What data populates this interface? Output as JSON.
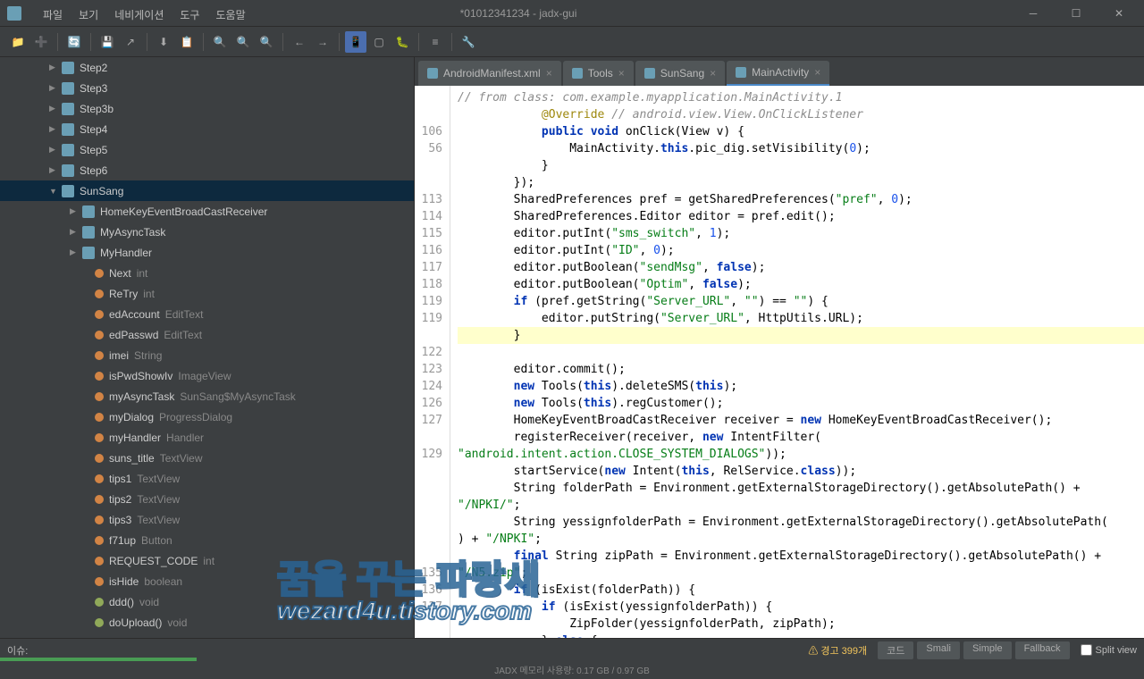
{
  "window": {
    "title": "*01012341234 - jadx-gui"
  },
  "menu": [
    "파일",
    "보기",
    "네비게이션",
    "도구",
    "도움말"
  ],
  "tree": [
    {
      "indent": 55,
      "arrow": "▶",
      "icon": "class",
      "name": "Step2",
      "type": ""
    },
    {
      "indent": 55,
      "arrow": "▶",
      "icon": "class",
      "name": "Step3",
      "type": ""
    },
    {
      "indent": 55,
      "arrow": "▶",
      "icon": "class",
      "name": "Step3b",
      "type": ""
    },
    {
      "indent": 55,
      "arrow": "▶",
      "icon": "class",
      "name": "Step4",
      "type": ""
    },
    {
      "indent": 55,
      "arrow": "▶",
      "icon": "class",
      "name": "Step5",
      "type": ""
    },
    {
      "indent": 55,
      "arrow": "▶",
      "icon": "class",
      "name": "Step6",
      "type": ""
    },
    {
      "indent": 55,
      "arrow": "▼",
      "icon": "class",
      "name": "SunSang",
      "type": "",
      "selected": true
    },
    {
      "indent": 78,
      "arrow": "▶",
      "icon": "class",
      "name": "HomeKeyEventBroadCastReceiver",
      "type": ""
    },
    {
      "indent": 78,
      "arrow": "▶",
      "icon": "class",
      "name": "MyAsyncTask",
      "type": ""
    },
    {
      "indent": 78,
      "arrow": "▶",
      "icon": "class",
      "name": "MyHandler",
      "type": ""
    },
    {
      "indent": 92,
      "arrow": "",
      "icon": "field",
      "name": "Next",
      "type": "int"
    },
    {
      "indent": 92,
      "arrow": "",
      "icon": "field",
      "name": "ReTry",
      "type": "int"
    },
    {
      "indent": 92,
      "arrow": "",
      "icon": "field",
      "name": "edAccount",
      "type": "EditText"
    },
    {
      "indent": 92,
      "arrow": "",
      "icon": "field",
      "name": "edPasswd",
      "type": "EditText"
    },
    {
      "indent": 92,
      "arrow": "",
      "icon": "field",
      "name": "imei",
      "type": "String"
    },
    {
      "indent": 92,
      "arrow": "",
      "icon": "field",
      "name": "isPwdShowIv",
      "type": "ImageView"
    },
    {
      "indent": 92,
      "arrow": "",
      "icon": "field",
      "name": "myAsyncTask",
      "type": "SunSang$MyAsyncTask"
    },
    {
      "indent": 92,
      "arrow": "",
      "icon": "field",
      "name": "myDialog",
      "type": "ProgressDialog"
    },
    {
      "indent": 92,
      "arrow": "",
      "icon": "field",
      "name": "myHandler",
      "type": "Handler"
    },
    {
      "indent": 92,
      "arrow": "",
      "icon": "field",
      "name": "suns_title",
      "type": "TextView"
    },
    {
      "indent": 92,
      "arrow": "",
      "icon": "field",
      "name": "tips1",
      "type": "TextView"
    },
    {
      "indent": 92,
      "arrow": "",
      "icon": "field",
      "name": "tips2",
      "type": "TextView"
    },
    {
      "indent": 92,
      "arrow": "",
      "icon": "field",
      "name": "tips3",
      "type": "TextView"
    },
    {
      "indent": 92,
      "arrow": "",
      "icon": "field",
      "name": "f71up",
      "type": "Button"
    },
    {
      "indent": 92,
      "arrow": "",
      "icon": "field",
      "name": "REQUEST_CODE",
      "type": "int"
    },
    {
      "indent": 92,
      "arrow": "",
      "icon": "field",
      "name": "isHide",
      "type": "boolean"
    },
    {
      "indent": 92,
      "arrow": "",
      "icon": "method",
      "name": "ddd()",
      "type": "void"
    },
    {
      "indent": 92,
      "arrow": "",
      "icon": "method",
      "name": "doUpload()",
      "type": "void"
    }
  ],
  "tabs": [
    {
      "label": "AndroidManifest.xml",
      "active": false
    },
    {
      "label": "Tools",
      "active": false
    },
    {
      "label": "SunSang",
      "active": false
    },
    {
      "label": "MainActivity",
      "active": true
    }
  ],
  "gutter": [
    "",
    "",
    "106",
    "56",
    "",
    "",
    "113",
    "114",
    "115",
    "116",
    "117",
    "118",
    "119",
    "119",
    "",
    "122",
    "123",
    "124",
    "126",
    "127",
    "",
    "129",
    "",
    "",
    "",
    "",
    "",
    "",
    "135",
    "136",
    "137",
    ""
  ],
  "status": {
    "issue": "이슈:",
    "warning": "경고 399개",
    "tabs": [
      "코드",
      "Smali",
      "Simple",
      "Fallback"
    ],
    "split": "Split view",
    "memory": "JADX 메모리 사용량: 0.17 GB / 0.97 GB"
  },
  "watermark": {
    "line1": "꿈을 꾸는 파랑새",
    "line2": "wezard4u.tistory.com"
  }
}
